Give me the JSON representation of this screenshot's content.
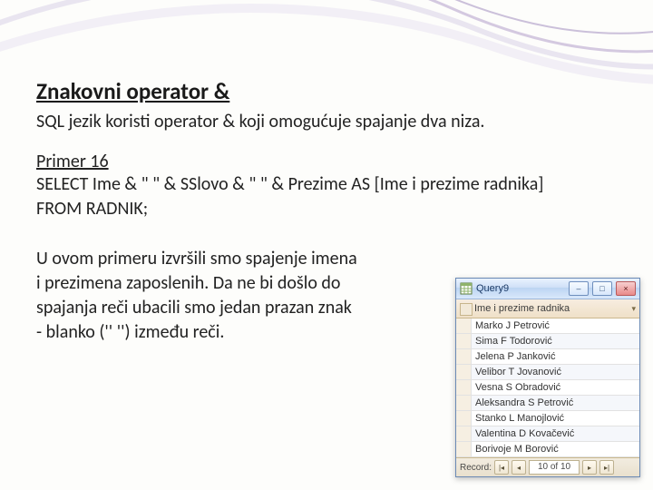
{
  "slide": {
    "title": "Znakovni operator &",
    "subtitle": "SQL jezik koristi operator & koji omogućuje spajanje dva niza.",
    "example_heading": "Primer 16",
    "code_line_1": "SELECT Ime & \" \" & SSlovo & \" \"  & Prezime AS [Ime i prezime radnika]",
    "code_line_2": "FROM RADNIK;",
    "explain_1": "U ovom primeru izvršili smo spajenje imena",
    "explain_2": " i prezimena zaposlenih. Da ne bi došlo do",
    "explain_3": "spajanja reči ubacili smo jedan prazan znak",
    "explain_4": "- blanko ('' '') između reči."
  },
  "query_window": {
    "title": "Query9",
    "column_header": "Ime i prezime radnika",
    "rows": [
      "Marko J Petrović",
      "Sima F Todorović",
      "Jelena P Janković",
      "Velibor T Jovanović",
      "Vesna S Obradović",
      "Aleksandra S Petrović",
      "Stanko L Manojlović",
      "Valentina D Kovačević",
      "Borivoje M Borović"
    ],
    "status": {
      "record_label": "Record:",
      "position": "10 of 10"
    }
  }
}
